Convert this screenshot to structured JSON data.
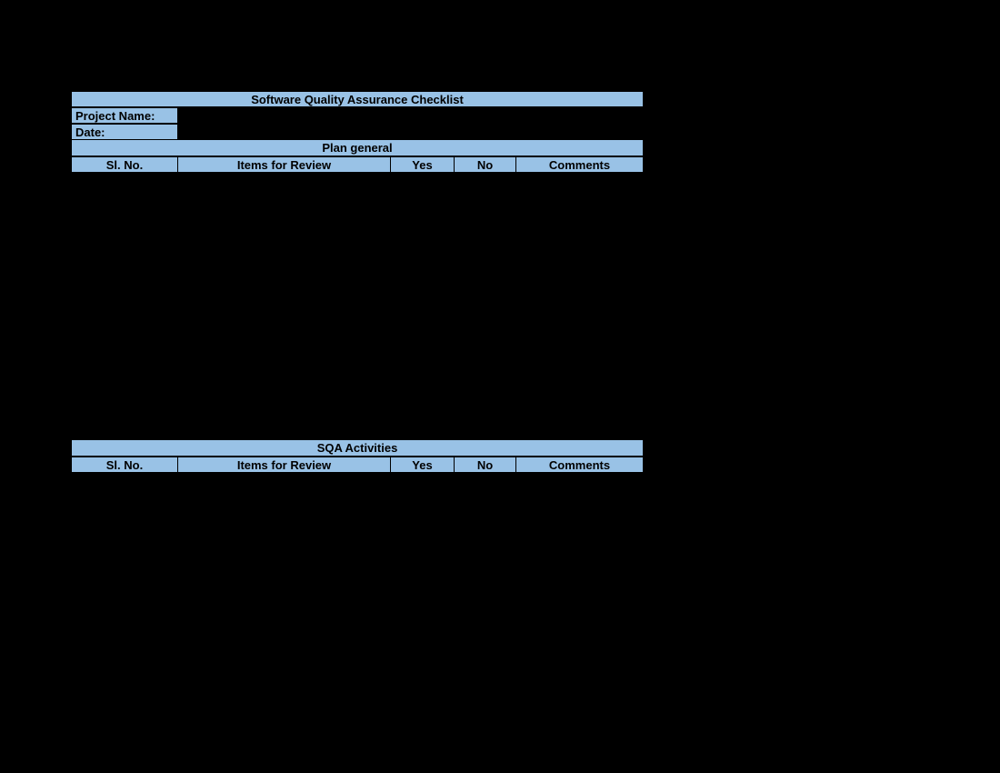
{
  "title": "Software Quality Assurance Checklist",
  "meta": {
    "project_label": "Project Name:",
    "date_label": "Date:"
  },
  "section1": {
    "heading": "Plan general",
    "headers": {
      "sl": "Sl. No.",
      "items": "Items for Review",
      "yes": "Yes",
      "no": "No",
      "comments": "Comments"
    }
  },
  "section2": {
    "heading": "SQA Activities",
    "headers": {
      "sl": "Sl. No.",
      "items": "Items for Review",
      "yes": "Yes",
      "no": "No",
      "comments": "Comments"
    }
  }
}
